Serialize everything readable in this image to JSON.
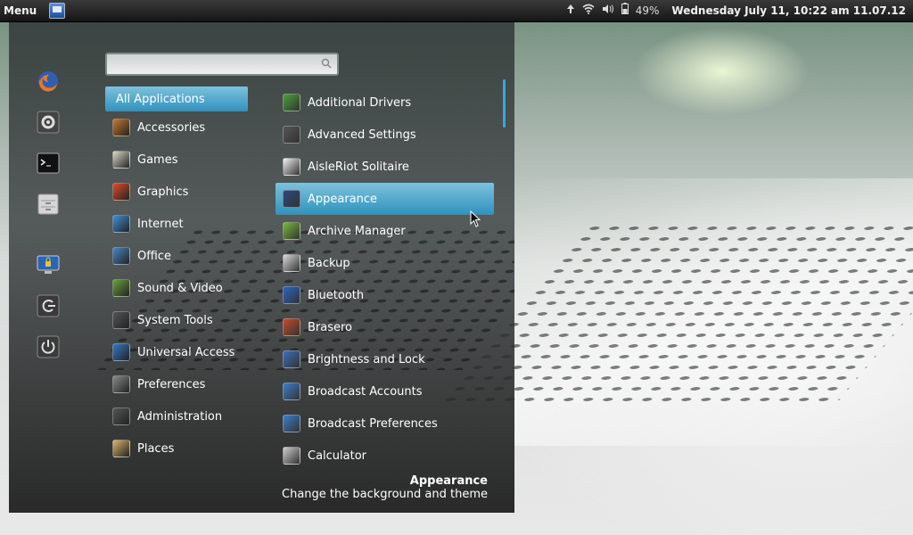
{
  "panel": {
    "menu_label": "Menu",
    "battery": "49%",
    "clock": "Wednesday July 11, 10:22 am 11.07.12",
    "tray_icons": [
      "network-up-icon",
      "wifi-icon",
      "volume-icon",
      "battery-icon"
    ]
  },
  "favorites": [
    {
      "name": "firefox-icon"
    },
    {
      "name": "settings-icon"
    },
    {
      "name": "terminal-icon"
    },
    {
      "name": "files-icon"
    },
    {
      "name": "lock-screen-icon"
    },
    {
      "name": "logout-icon"
    },
    {
      "name": "power-icon"
    }
  ],
  "search": {
    "value": "",
    "placeholder": ""
  },
  "categories": [
    {
      "label": "All Applications",
      "selected": true
    },
    {
      "label": "Accessories",
      "icon": "accessories-icon",
      "color": "#c9782c"
    },
    {
      "label": "Games",
      "icon": "games-icon",
      "color": "#d8d8c8"
    },
    {
      "label": "Graphics",
      "icon": "graphics-icon",
      "color": "#e04a2a"
    },
    {
      "label": "Internet",
      "icon": "internet-icon",
      "color": "#3f8fd8"
    },
    {
      "label": "Office",
      "icon": "office-icon",
      "color": "#4a86c4"
    },
    {
      "label": "Sound & Video",
      "icon": "sound-video-icon",
      "color": "#6aa03a"
    },
    {
      "label": "System Tools",
      "icon": "system-tools-icon",
      "color": "#555555"
    },
    {
      "label": "Universal Access",
      "icon": "universal-access-icon",
      "color": "#3378c9"
    },
    {
      "label": "Preferences",
      "icon": "preferences-icon",
      "color": "#888888"
    },
    {
      "label": "Administration",
      "icon": "administration-icon",
      "color": "#555555"
    },
    {
      "label": "Places",
      "icon": "places-icon",
      "color": "#d9b36a"
    }
  ],
  "apps": [
    {
      "label": "Additional Drivers",
      "icon": "additional-drivers-icon",
      "color": "#4aa03a"
    },
    {
      "label": "Advanced Settings",
      "icon": "advanced-settings-icon",
      "color": "#555555"
    },
    {
      "label": "AisleRiot Solitaire",
      "icon": "solitaire-icon",
      "color": "#f0f0f0"
    },
    {
      "label": "Appearance",
      "icon": "appearance-icon",
      "color": "#2a4a80",
      "selected": true
    },
    {
      "label": "Archive Manager",
      "icon": "archive-manager-icon",
      "color": "#7ab83a"
    },
    {
      "label": "Backup",
      "icon": "backup-icon",
      "color": "#d8d8d8"
    },
    {
      "label": "Bluetooth",
      "icon": "bluetooth-icon",
      "color": "#2a64c4"
    },
    {
      "label": "Brasero",
      "icon": "brasero-icon",
      "color": "#c84a2a"
    },
    {
      "label": "Brightness and Lock",
      "icon": "brightness-lock-icon",
      "color": "#3a6fb8"
    },
    {
      "label": "Broadcast Accounts",
      "icon": "broadcast-accounts-icon",
      "color": "#3a7fd0"
    },
    {
      "label": "Broadcast Preferences",
      "icon": "broadcast-preferences-icon",
      "color": "#3a7fd0"
    },
    {
      "label": "Calculator",
      "icon": "calculator-icon",
      "color": "#cccccc"
    }
  ],
  "description": {
    "title": "Appearance",
    "text": "Change the background and theme"
  },
  "colors": {
    "selection_top": "#7ec1dc",
    "selection_bottom": "#2f92bd"
  }
}
